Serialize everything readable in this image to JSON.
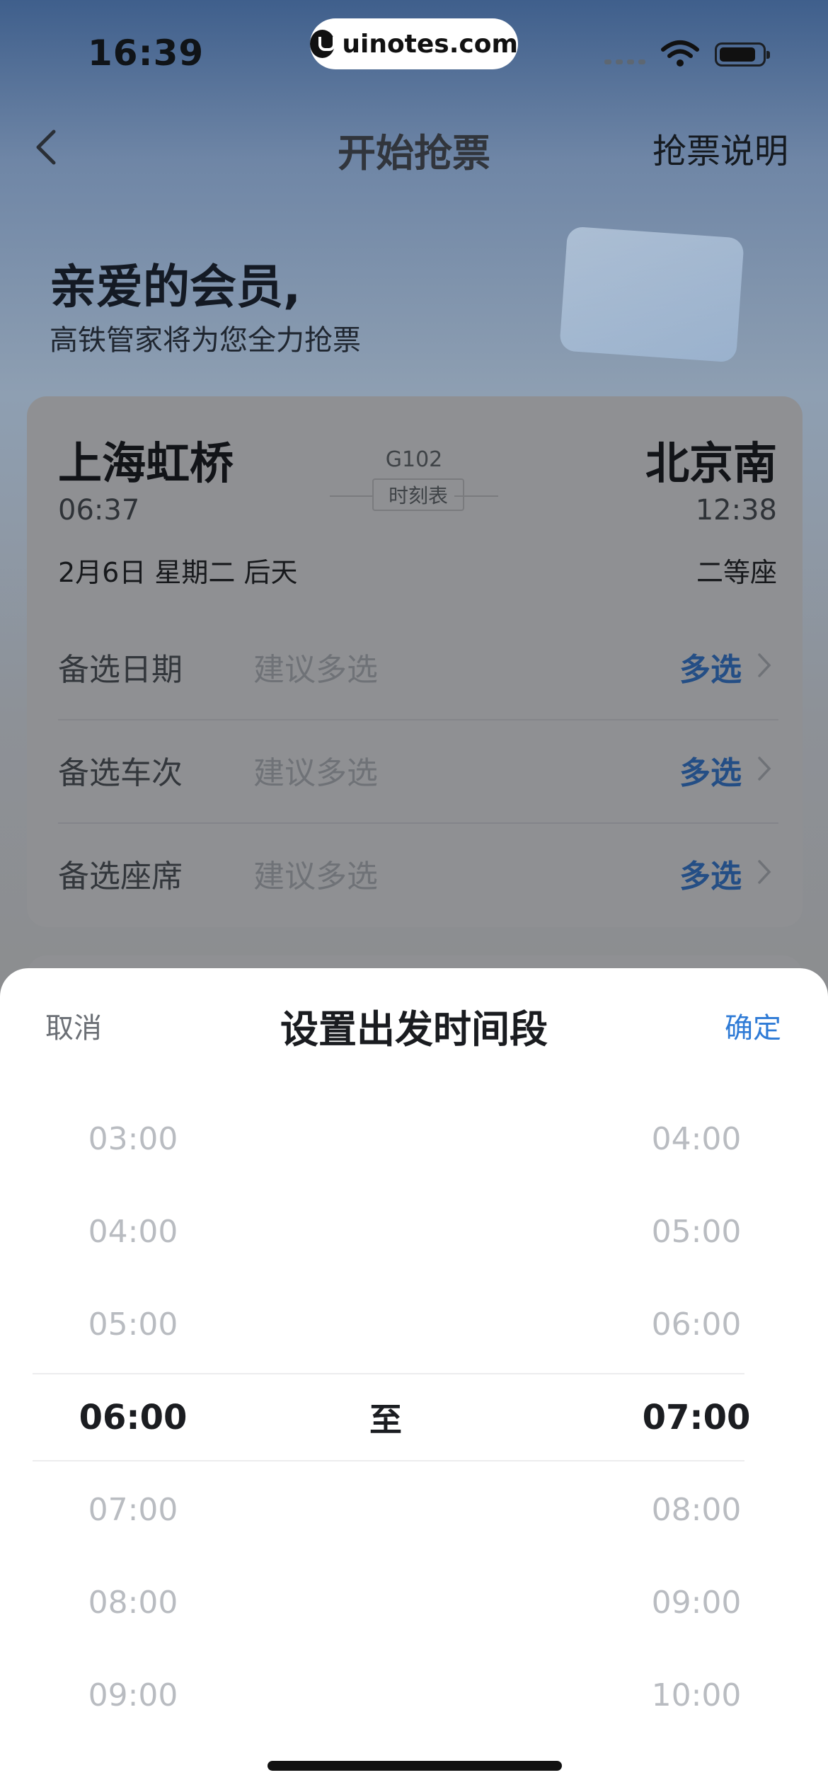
{
  "status_bar": {
    "time": "16:39",
    "watermark": "uinotes.com"
  },
  "nav": {
    "title": "开始抢票",
    "right_action": "抢票说明"
  },
  "hero": {
    "greeting": "亲爱的会员,",
    "subtitle": "高铁管家将为您全力抢票"
  },
  "trip": {
    "from_station": "上海虹桥",
    "to_station": "北京南",
    "depart_time": "06:37",
    "arrive_time": "12:38",
    "train_no": "G102",
    "timetable_label": "时刻表",
    "date": "2月6日 星期二 后天",
    "seat_class": "二等座"
  },
  "options": [
    {
      "label": "备选日期",
      "hint": "建议多选",
      "action": "多选"
    },
    {
      "label": "备选车次",
      "hint": "建议多选",
      "action": "多选"
    },
    {
      "label": "备选座席",
      "hint": "建议多选",
      "action": "多选"
    }
  ],
  "sheet": {
    "cancel": "取消",
    "title": "设置出发时间段",
    "confirm": "确定",
    "separator": "至",
    "start_times": [
      "03:00",
      "04:00",
      "05:00",
      "06:00",
      "07:00",
      "08:00",
      "09:00"
    ],
    "end_times": [
      "04:00",
      "05:00",
      "06:00",
      "07:00",
      "08:00",
      "09:00",
      "10:00"
    ],
    "selected_start": "06:00",
    "selected_end": "07:00"
  },
  "colors": {
    "accent": "#2f7bd6",
    "option_action": "#244e85"
  }
}
